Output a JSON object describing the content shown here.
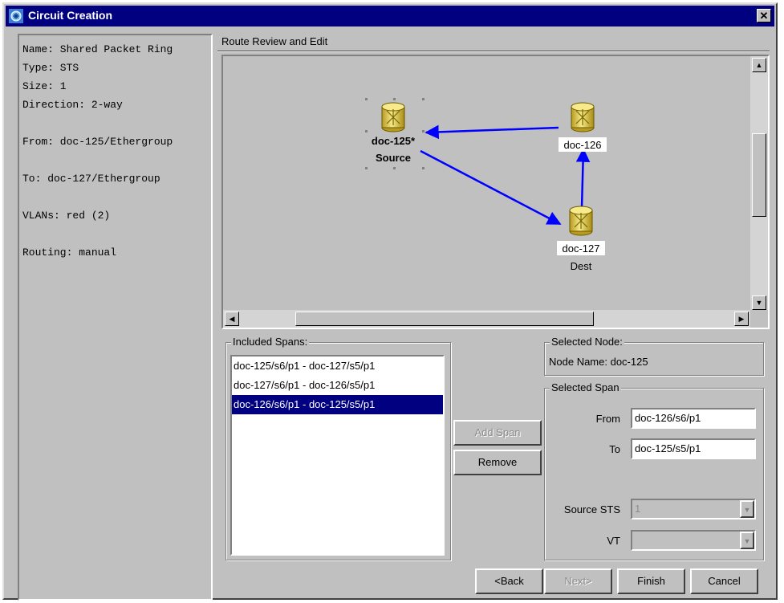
{
  "window": {
    "title": "Circuit Creation",
    "close_glyph": "✕"
  },
  "info": {
    "lines": [
      "Name: Shared Packet Ring",
      "Type: STS",
      "Size: 1",
      "Direction: 2-way",
      "",
      "From: doc-125/Ethergroup",
      "",
      "To: doc-127/Ethergroup",
      "",
      "VLANs: red (2)",
      "",
      "Routing: manual"
    ]
  },
  "route": {
    "label": "Route Review and Edit",
    "nodes": [
      {
        "name": "doc-125*",
        "role": "Source",
        "selected": true,
        "icon": "router-icon"
      },
      {
        "name": "doc-126",
        "role": "",
        "selected": false,
        "icon": "router-icon"
      },
      {
        "name": "doc-127",
        "role": "Dest",
        "selected": false,
        "icon": "router-icon"
      }
    ],
    "link_color": "#0000ff"
  },
  "included_spans": {
    "label": "Included Spans:",
    "items": [
      "doc-125/s6/p1 - doc-127/s5/p1",
      "doc-127/s6/p1 - doc-126/s5/p1",
      "doc-126/s6/p1 - doc-125/s5/p1"
    ],
    "selected_index": 2
  },
  "actions": {
    "add_span": "Add Span",
    "remove": "Remove"
  },
  "selected_node": {
    "label": "Selected Node:",
    "text": "Node Name: doc-125"
  },
  "selected_span": {
    "label": "Selected Span",
    "from_label": "From",
    "from_value": "doc-126/s6/p1",
    "to_label": "To",
    "to_value": "doc-125/s5/p1",
    "source_sts_label": "Source STS",
    "source_sts_value": "1",
    "vt_label": "VT",
    "vt_value": ""
  },
  "footer": {
    "back": "<Back",
    "next": "Next>",
    "finish": "Finish",
    "cancel": "Cancel"
  },
  "colors": {
    "title_bar": "#000080",
    "selection": "#000080",
    "node_fill": "#e8d870"
  }
}
